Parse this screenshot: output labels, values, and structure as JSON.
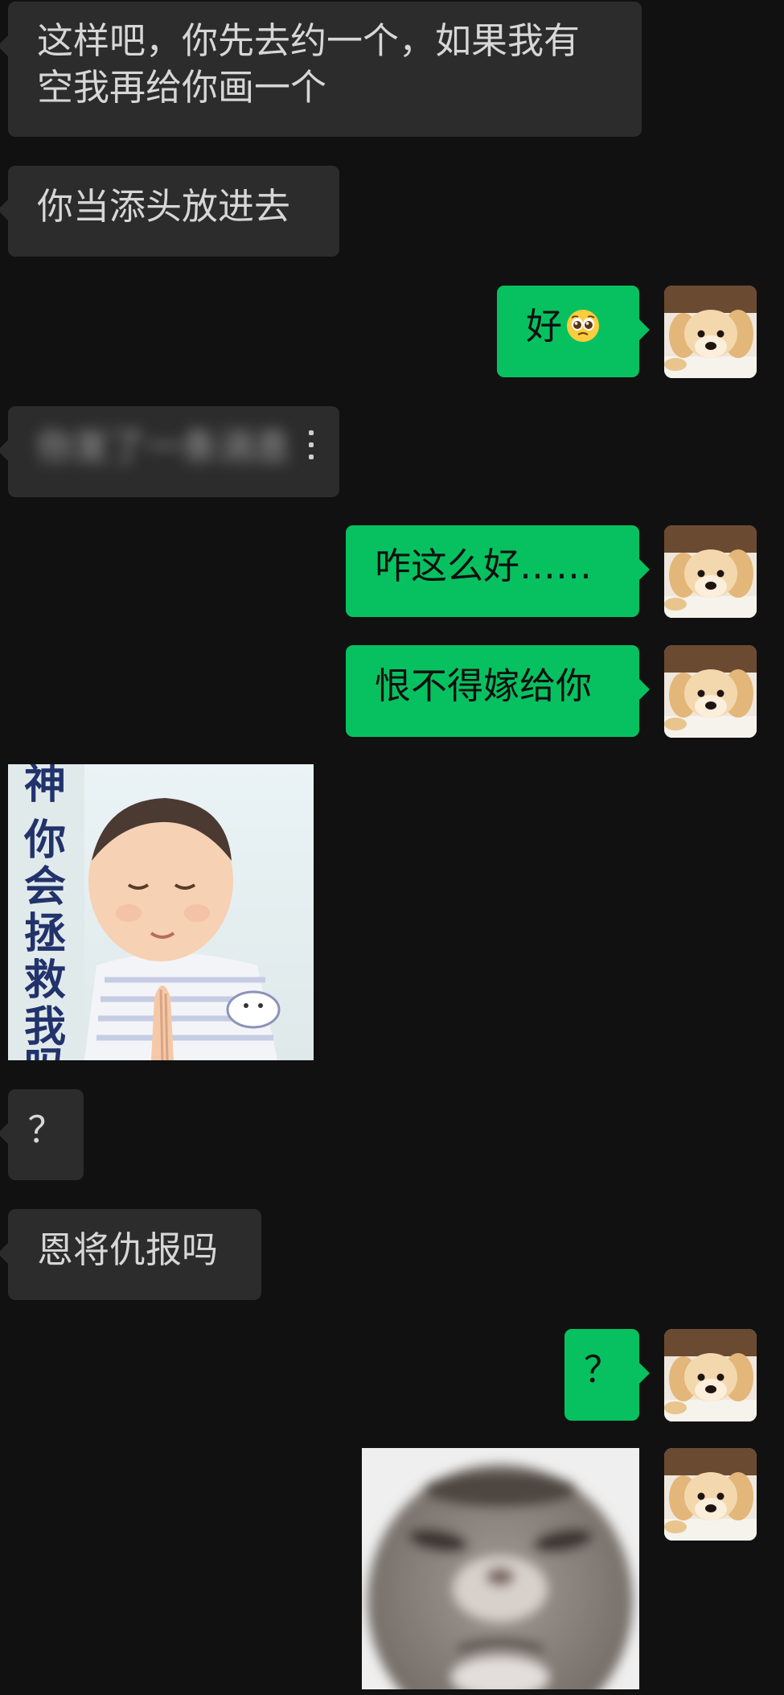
{
  "messages": [
    {
      "side": "in",
      "text": "这样吧，你先去约一个，如果我有空我再给你画一个"
    },
    {
      "side": "in",
      "text": "你当添头放进去"
    },
    {
      "side": "out",
      "text": "好",
      "emoji": "pleading-face-emoji"
    },
    {
      "side": "in",
      "text": "你发了一条消息",
      "blurred": true
    },
    {
      "side": "out",
      "text": "咋这么好……"
    },
    {
      "side": "out",
      "text": "恨不得嫁给你"
    },
    {
      "side": "in",
      "sticker": "praying-baby-sticker",
      "sticker_caption": "神你会拯救我吗"
    },
    {
      "side": "in",
      "text": "？"
    },
    {
      "side": "in",
      "text": "恩将仇报吗"
    },
    {
      "side": "out",
      "text": "？"
    },
    {
      "side": "out",
      "sticker": "grumpy-cat-face-sticker"
    }
  ],
  "avatar": {
    "icon": "golden-retriever-puppy-avatar"
  },
  "colors": {
    "background": "#111111",
    "incoming_bubble": "#2c2c2c",
    "outgoing_bubble": "#07c160"
  }
}
